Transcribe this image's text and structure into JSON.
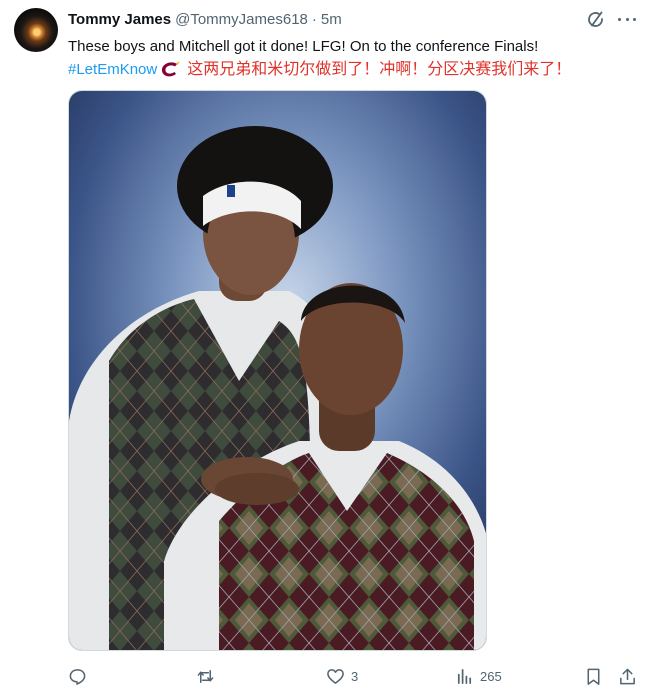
{
  "author": {
    "name": "Tommy James",
    "handle": "@TommyJames618",
    "separator": "·",
    "time": "5m"
  },
  "tweet": {
    "text": "These boys and Mitchell got it done! LFG! On to the conference Finals!",
    "hashtag": "#LetEmKnow",
    "translation": "这两兄弟和米切尔做到了！冲啊！分区决赛我们来了！"
  },
  "icons": {
    "grok": "grok-icon",
    "more": "more-dots-icon",
    "hashtag_emoji": "cavaliers-c-logo-icon"
  },
  "actions": {
    "reply": {
      "icon": "reply-icon",
      "count": ""
    },
    "retweet": {
      "icon": "retweet-icon",
      "count": ""
    },
    "like": {
      "icon": "heart-icon",
      "count": "3"
    },
    "views": {
      "icon": "views-icon",
      "count": "265"
    },
    "bookmark": {
      "icon": "bookmark-icon"
    },
    "share": {
      "icon": "share-icon"
    }
  },
  "colors": {
    "hashtag": "#1d9bf0",
    "translation": "#e0332b",
    "muted": "#536471",
    "cavs_wine": "#860038"
  }
}
